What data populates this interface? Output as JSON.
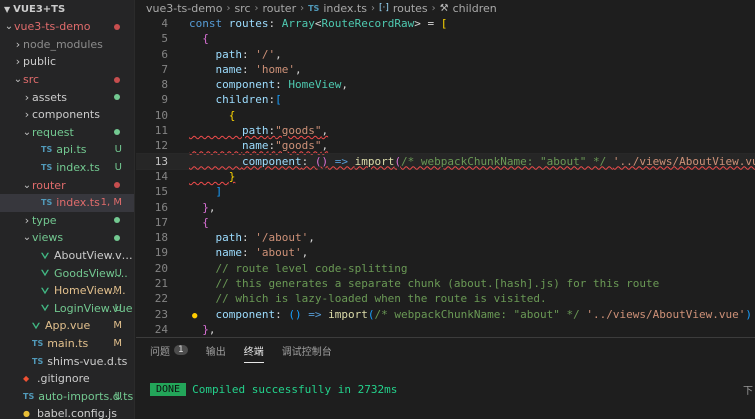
{
  "sidebar": {
    "header": "VUE3+TS",
    "items": [
      {
        "label": "vue3-ts-demo",
        "depth": 0,
        "kind": "folder-open",
        "status": "dot",
        "status_color": "#c74e4e",
        "label_color": "#e06c6c"
      },
      {
        "label": "node_modules",
        "depth": 1,
        "kind": "folder",
        "status": "",
        "label_color": "#8c8c8c"
      },
      {
        "label": "public",
        "depth": 1,
        "kind": "folder",
        "status": "",
        "label_color": "#cccccc"
      },
      {
        "label": "src",
        "depth": 1,
        "kind": "folder-open",
        "status": "dot",
        "status_color": "#c74e4e",
        "label_color": "#e06c6c"
      },
      {
        "label": "assets",
        "depth": 2,
        "kind": "folder",
        "status": "dot",
        "status_color": "#73c991",
        "label_color": "#cccccc"
      },
      {
        "label": "components",
        "depth": 2,
        "kind": "folder",
        "status": "",
        "label_color": "#cccccc"
      },
      {
        "label": "request",
        "depth": 2,
        "kind": "folder-open",
        "status": "dot",
        "status_color": "#73c991",
        "label_color": "#73c991"
      },
      {
        "label": "api.ts",
        "depth": 3,
        "kind": "ts",
        "status": "U",
        "status_color": "#73c991",
        "label_color": "#73c991"
      },
      {
        "label": "index.ts",
        "depth": 3,
        "kind": "ts",
        "status": "U",
        "status_color": "#73c991",
        "label_color": "#73c991"
      },
      {
        "label": "router",
        "depth": 2,
        "kind": "folder-open",
        "status": "dot",
        "status_color": "#c74e4e",
        "label_color": "#e06c6c"
      },
      {
        "label": "index.ts",
        "depth": 3,
        "kind": "ts",
        "status": "1, M",
        "status_color": "#e06c6c",
        "label_color": "#e06c6c",
        "selected": true
      },
      {
        "label": "type",
        "depth": 2,
        "kind": "folder",
        "status": "dot",
        "status_color": "#73c991",
        "label_color": "#73c991"
      },
      {
        "label": "views",
        "depth": 2,
        "kind": "folder-open",
        "status": "dot",
        "status_color": "#73c991",
        "label_color": "#73c991"
      },
      {
        "label": "AboutView.vue",
        "depth": 3,
        "kind": "vue",
        "status": "",
        "label_color": "#cccccc"
      },
      {
        "label": "GoodsView....",
        "depth": 3,
        "kind": "vue",
        "status": "U",
        "status_color": "#73c991",
        "label_color": "#73c991"
      },
      {
        "label": "HomeView....",
        "depth": 3,
        "kind": "vue",
        "status": "M",
        "status_color": "#e2c08d",
        "label_color": "#e2c08d"
      },
      {
        "label": "LoginView.vue",
        "depth": 3,
        "kind": "vue",
        "status": "U",
        "status_color": "#73c991",
        "label_color": "#73c991"
      },
      {
        "label": "App.vue",
        "depth": 2,
        "kind": "vue",
        "status": "M",
        "status_color": "#e2c08d",
        "label_color": "#e2c08d"
      },
      {
        "label": "main.ts",
        "depth": 2,
        "kind": "ts",
        "status": "M",
        "status_color": "#e2c08d",
        "label_color": "#e2c08d"
      },
      {
        "label": "shims-vue.d.ts",
        "depth": 2,
        "kind": "ts",
        "status": "",
        "label_color": "#cccccc"
      },
      {
        "label": ".gitignore",
        "depth": 1,
        "kind": "git",
        "status": "",
        "label_color": "#cccccc"
      },
      {
        "label": "auto-imports.d.ts",
        "depth": 1,
        "kind": "ts",
        "status": "U",
        "status_color": "#73c991",
        "label_color": "#73c991"
      },
      {
        "label": "babel.config.js",
        "depth": 1,
        "kind": "js",
        "status": "",
        "label_color": "#cccccc"
      }
    ]
  },
  "breadcrumb": {
    "parts": [
      "vue3-ts-demo",
      "src",
      "router",
      "index.ts",
      "routes",
      "children"
    ]
  },
  "editor": {
    "active_line": 13,
    "lines": [
      {
        "n": 4,
        "tokens": [
          [
            "kw",
            "const "
          ],
          [
            "var",
            "routes"
          ],
          [
            "punc",
            ": "
          ],
          [
            "type",
            "Array"
          ],
          [
            "punc",
            "<"
          ],
          [
            "type",
            "RouteRecordRaw"
          ],
          [
            "punc",
            "> = "
          ],
          [
            "br1",
            "["
          ]
        ]
      },
      {
        "n": 5,
        "tokens": [
          [
            "punc",
            "  "
          ],
          [
            "br2",
            "{"
          ]
        ]
      },
      {
        "n": 6,
        "tokens": [
          [
            "punc",
            "    "
          ],
          [
            "var",
            "path"
          ],
          [
            "punc",
            ": "
          ],
          [
            "str",
            "'/'"
          ],
          [
            "punc",
            ","
          ]
        ]
      },
      {
        "n": 7,
        "tokens": [
          [
            "punc",
            "    "
          ],
          [
            "var",
            "name"
          ],
          [
            "punc",
            ": "
          ],
          [
            "str",
            "'home'"
          ],
          [
            "punc",
            ","
          ]
        ]
      },
      {
        "n": 8,
        "tokens": [
          [
            "punc",
            "    "
          ],
          [
            "var",
            "component"
          ],
          [
            "punc",
            ": "
          ],
          [
            "type",
            "HomeView"
          ],
          [
            "punc",
            ","
          ]
        ]
      },
      {
        "n": 9,
        "tokens": [
          [
            "punc",
            "    "
          ],
          [
            "var",
            "children"
          ],
          [
            "punc",
            ":"
          ],
          [
            "br3",
            "["
          ]
        ]
      },
      {
        "n": 10,
        "tokens": [
          [
            "punc",
            "      "
          ],
          [
            "br1",
            "{"
          ]
        ]
      },
      {
        "n": 11,
        "tokens": [
          [
            "punc",
            "        "
          ],
          [
            "var",
            "path"
          ],
          [
            "punc",
            ":"
          ],
          [
            "str",
            "\"goods\""
          ],
          [
            "punc",
            ","
          ]
        ],
        "squiggle": true
      },
      {
        "n": 12,
        "tokens": [
          [
            "punc",
            "        "
          ],
          [
            "var",
            "name"
          ],
          [
            "punc",
            ":"
          ],
          [
            "str",
            "\"goods\""
          ],
          [
            "punc",
            ","
          ]
        ],
        "squiggle": true
      },
      {
        "n": 13,
        "tokens": [
          [
            "punc",
            "        "
          ],
          [
            "var",
            "component"
          ],
          [
            "punc",
            ": "
          ],
          [
            "br2",
            "()"
          ],
          [
            "kw",
            " => "
          ],
          [
            "fn",
            "import"
          ],
          [
            "br2",
            "("
          ],
          [
            "cm",
            "/* webpackChunkName: \"about\" */ "
          ],
          [
            "str",
            "'../views/AboutView.vue'"
          ],
          [
            "br2",
            ")"
          ]
        ],
        "squiggle": true
      },
      {
        "n": 14,
        "tokens": [
          [
            "punc",
            "      "
          ],
          [
            "br1",
            "}"
          ]
        ],
        "squiggle": true
      },
      {
        "n": 15,
        "tokens": [
          [
            "punc",
            "    "
          ],
          [
            "br3",
            "]"
          ]
        ]
      },
      {
        "n": 16,
        "tokens": [
          [
            "punc",
            "  "
          ],
          [
            "br2",
            "}"
          ],
          [
            "punc",
            ","
          ]
        ]
      },
      {
        "n": 17,
        "tokens": [
          [
            "punc",
            "  "
          ],
          [
            "br2",
            "{"
          ]
        ]
      },
      {
        "n": 18,
        "tokens": [
          [
            "punc",
            "    "
          ],
          [
            "var",
            "path"
          ],
          [
            "punc",
            ": "
          ],
          [
            "str",
            "'/about'"
          ],
          [
            "punc",
            ","
          ]
        ]
      },
      {
        "n": 19,
        "tokens": [
          [
            "punc",
            "    "
          ],
          [
            "var",
            "name"
          ],
          [
            "punc",
            ": "
          ],
          [
            "str",
            "'about'"
          ],
          [
            "punc",
            ","
          ]
        ]
      },
      {
        "n": 20,
        "tokens": [
          [
            "punc",
            "    "
          ],
          [
            "cm",
            "// route level code-splitting"
          ]
        ]
      },
      {
        "n": 21,
        "tokens": [
          [
            "punc",
            "    "
          ],
          [
            "cm",
            "// this generates a separate chunk (about.[hash].js) for this route"
          ]
        ]
      },
      {
        "n": 22,
        "tokens": [
          [
            "punc",
            "    "
          ],
          [
            "cm",
            "// which is lazy-loaded when the route is visited."
          ]
        ]
      },
      {
        "n": 23,
        "tokens": [
          [
            "punc",
            "    "
          ],
          [
            "var",
            "component"
          ],
          [
            "punc",
            ": "
          ],
          [
            "br3",
            "()"
          ],
          [
            "kw",
            " => "
          ],
          [
            "fn",
            "import"
          ],
          [
            "br3",
            "("
          ],
          [
            "cm",
            "/* webpackChunkName: \"about\" */ "
          ],
          [
            "str",
            "'../views/AboutView.vue'"
          ],
          [
            "br3",
            ")"
          ]
        ],
        "bulb": true
      },
      {
        "n": 24,
        "tokens": [
          [
            "punc",
            "  "
          ],
          [
            "br2",
            "}"
          ],
          [
            "punc",
            ","
          ]
        ]
      }
    ]
  },
  "panel": {
    "tabs": [
      {
        "label": "问题",
        "badge": "1",
        "active": false
      },
      {
        "label": "输出",
        "active": false
      },
      {
        "label": "终端",
        "active": true
      },
      {
        "label": "调试控制台",
        "active": false
      }
    ],
    "terminal": {
      "badge": "DONE",
      "message": "Compiled successfully in 2732ms"
    },
    "corner_text": "下"
  }
}
